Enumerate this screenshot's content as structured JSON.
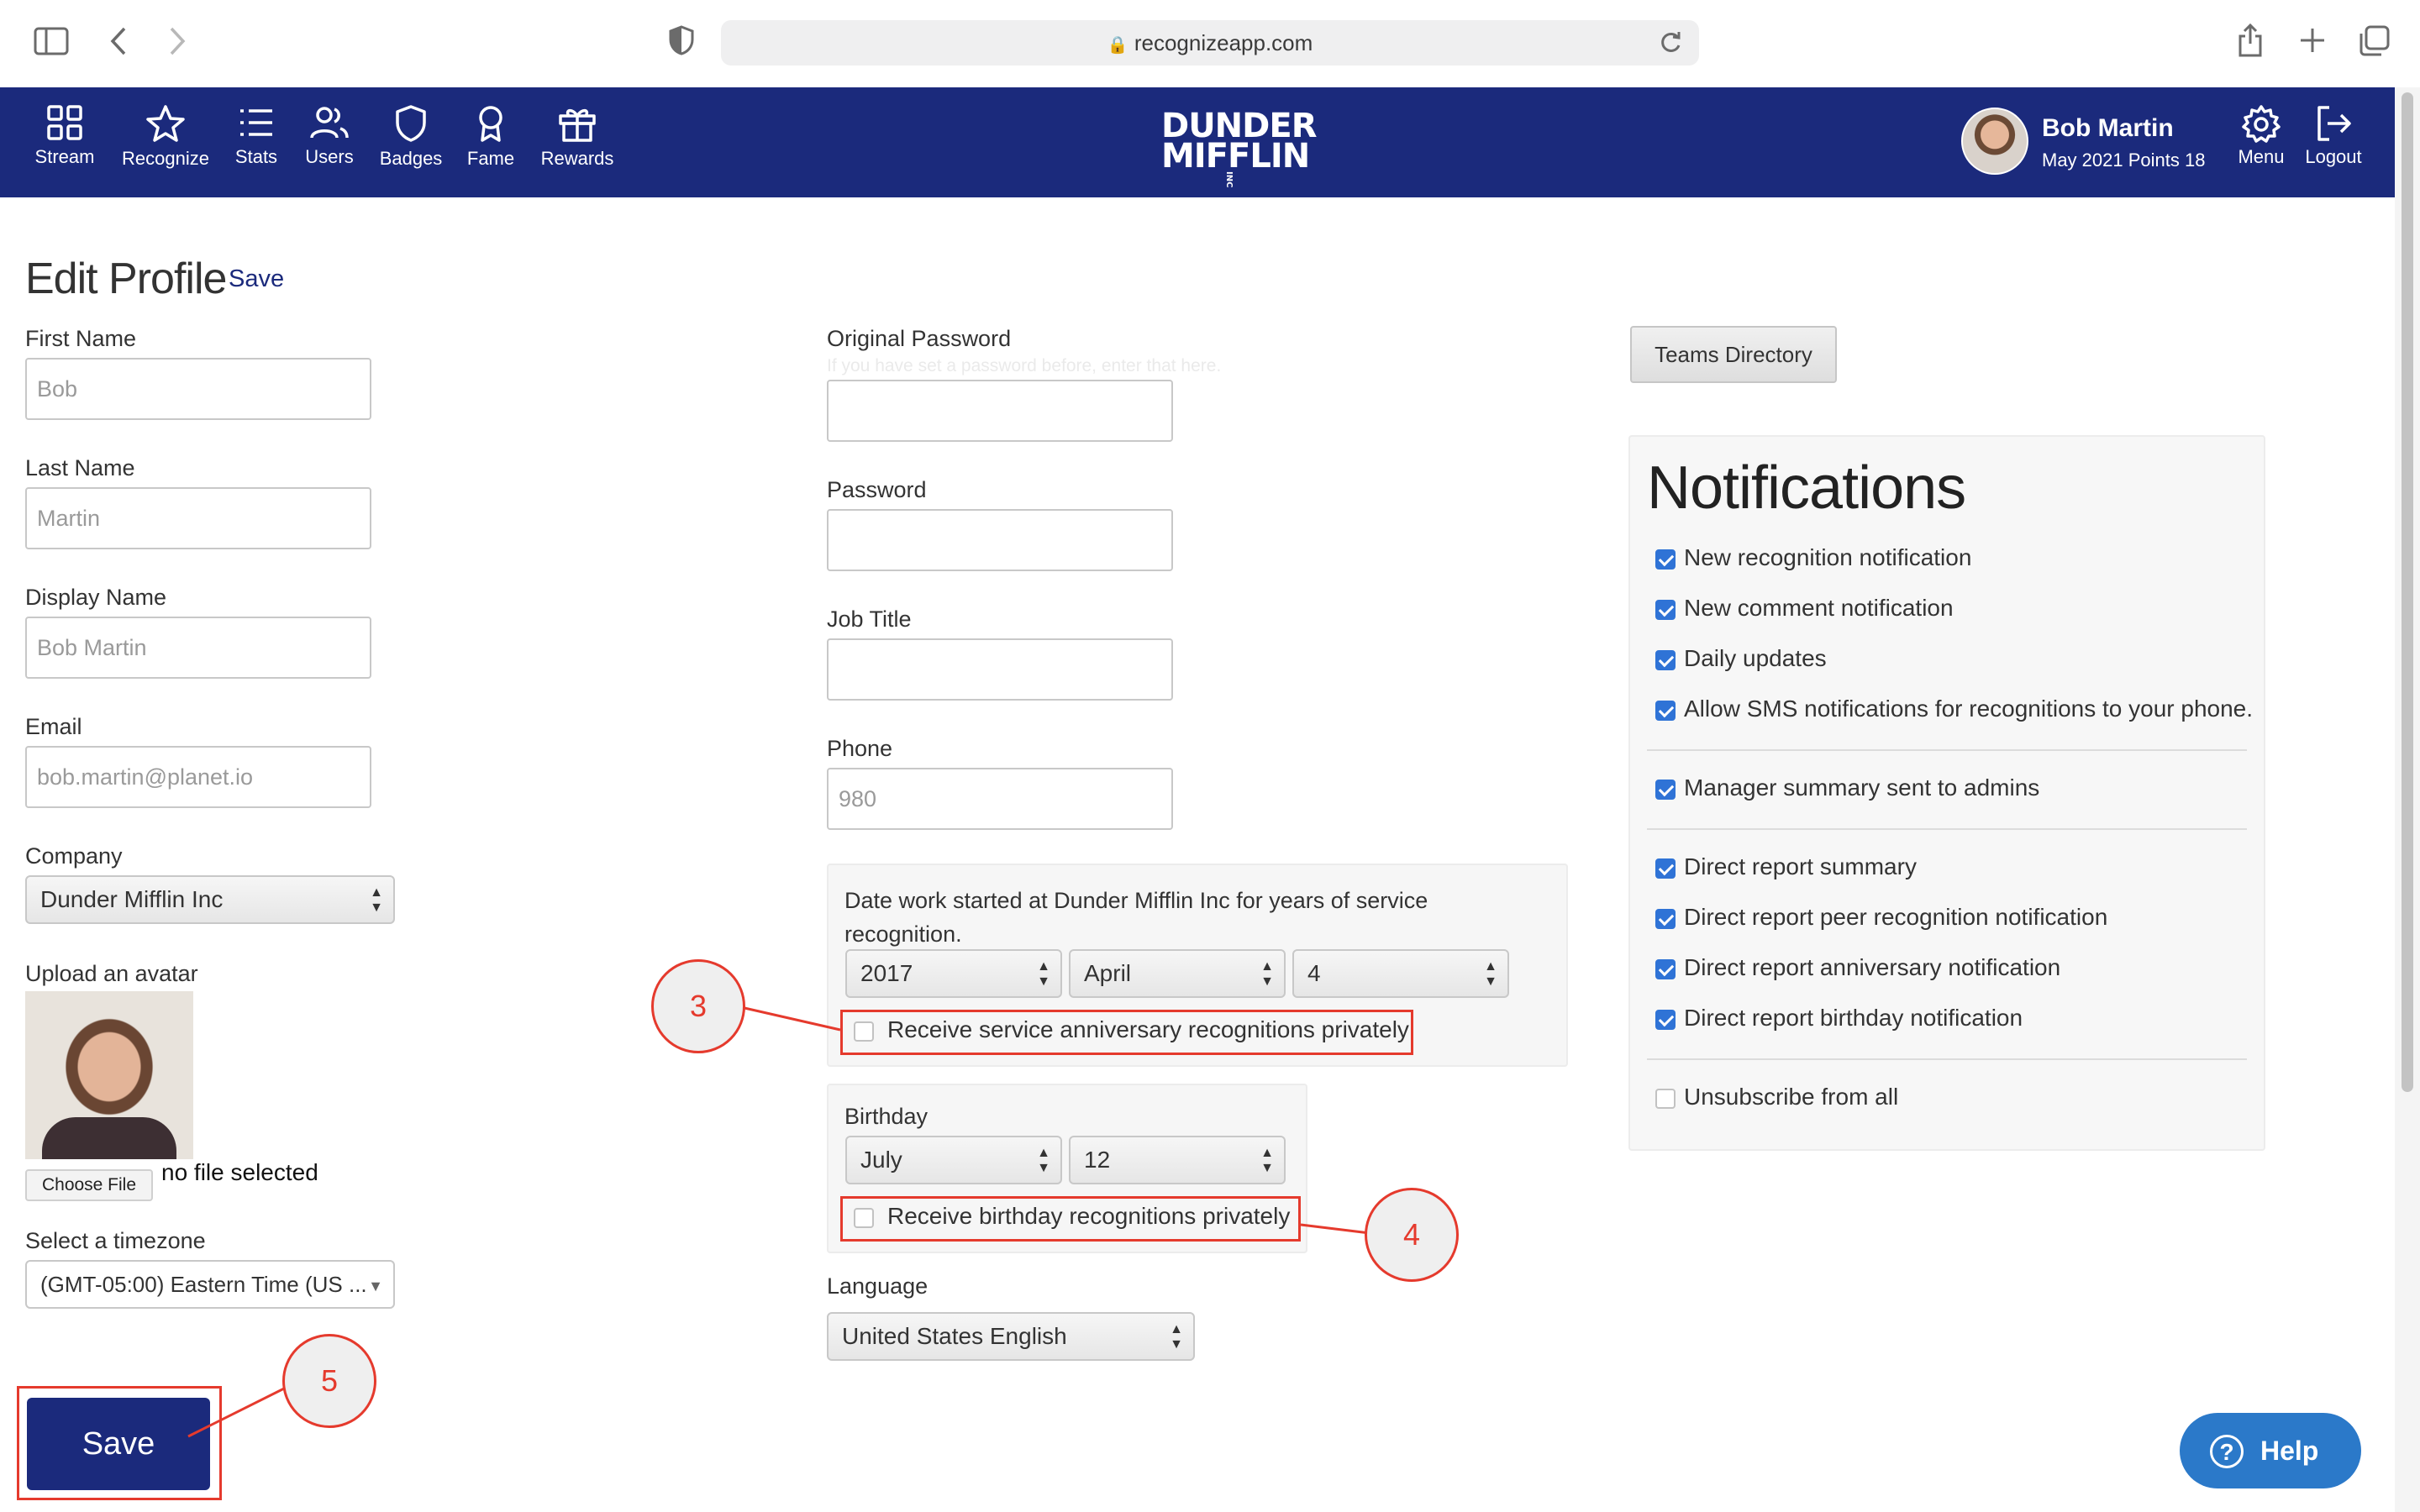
{
  "browser": {
    "url": "recognizeapp.com"
  },
  "nav": {
    "items": [
      {
        "label": "Stream",
        "icon": "grid-icon"
      },
      {
        "label": "Recognize",
        "icon": "star-icon"
      },
      {
        "label": "Stats",
        "icon": "list-icon"
      },
      {
        "label": "Users",
        "icon": "users-icon"
      },
      {
        "label": "Badges",
        "icon": "shield-icon"
      },
      {
        "label": "Fame",
        "icon": "ribbon-icon"
      },
      {
        "label": "Rewards",
        "icon": "gift-icon"
      }
    ],
    "brand_line1": "DUNDER",
    "brand_line2": "MIFFLIN",
    "brand_suffix": "INC",
    "user_name": "Bob Martin",
    "user_points": "May 2021 Points 18",
    "menu_label": "Menu",
    "logout_label": "Logout"
  },
  "page": {
    "title": "Edit Profile",
    "title_save": "Save"
  },
  "left_form": {
    "first_name": {
      "label": "First Name",
      "value": "Bob"
    },
    "last_name": {
      "label": "Last Name",
      "value": "Martin"
    },
    "display_name": {
      "label": "Display Name",
      "value": "Bob Martin"
    },
    "email": {
      "label": "Email",
      "value": "bob.martin@planet.io"
    },
    "company": {
      "label": "Company",
      "value": "Dunder Mifflin Inc"
    },
    "avatar": {
      "label": "Upload an avatar",
      "choose_file": "Choose File",
      "status": "no file selected"
    },
    "timezone": {
      "label": "Select a timezone",
      "value": "(GMT-05:00) Eastern Time (US ..."
    },
    "save_button": "Save"
  },
  "middle_form": {
    "original_password": {
      "label": "Original Password",
      "hint": "If you have set a password before, enter that here.",
      "value": ""
    },
    "password": {
      "label": "Password",
      "value": ""
    },
    "job_title": {
      "label": "Job Title",
      "value": ""
    },
    "phone": {
      "label": "Phone",
      "value": "980"
    },
    "service": {
      "label": "Date work started at Dunder Mifflin Inc for years of service recognition.",
      "year": "2017",
      "month": "April",
      "day": "4",
      "private_label": "Receive service anniversary recognitions privately",
      "private_checked": false
    },
    "birthday": {
      "label": "Birthday",
      "month": "July",
      "day": "12",
      "private_label": "Receive birthday recognitions privately",
      "private_checked": false
    },
    "language": {
      "label": "Language",
      "value": "United States English"
    }
  },
  "right_panel": {
    "teams_button": "Teams Directory",
    "notifications_title": "Notifications",
    "options": [
      {
        "label": "New recognition notification",
        "checked": true
      },
      {
        "label": "New comment notification",
        "checked": true
      },
      {
        "label": "Daily updates",
        "checked": true
      },
      {
        "label": "Allow SMS notifications for recognitions to your phone.",
        "checked": true
      },
      {
        "label": "Manager summary sent to admins",
        "checked": true
      },
      {
        "label": "Direct report summary",
        "checked": true
      },
      {
        "label": "Direct report peer recognition notification",
        "checked": true
      },
      {
        "label": "Direct report anniversary notification",
        "checked": true
      },
      {
        "label": "Direct report birthday notification",
        "checked": true
      },
      {
        "label": "Unsubscribe from all",
        "checked": false
      }
    ]
  },
  "annotations": {
    "callout_3": "3",
    "callout_4": "4",
    "callout_5": "5",
    "color": "#e53a2d"
  },
  "help": {
    "label": "Help"
  },
  "colors": {
    "nav_background": "#1b2a7c",
    "checkbox_checked": "#2f73d6",
    "help_button": "#2b79c9"
  }
}
